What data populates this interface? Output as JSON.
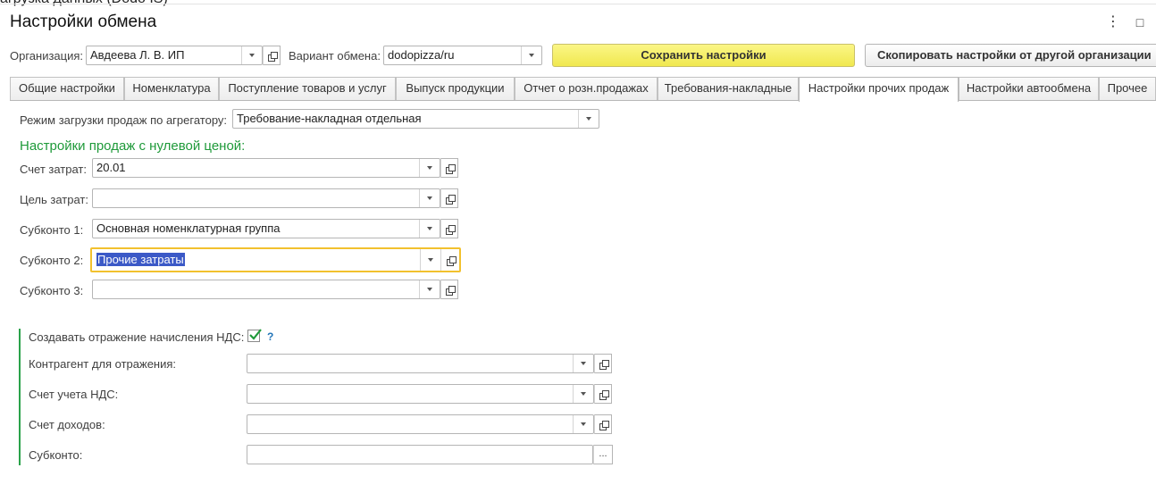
{
  "clipped_title": "агрузка данных (Dodo IS)",
  "window": {
    "title": "Настройки обмена",
    "more_icon": "⋮",
    "maximize_icon": "□"
  },
  "header": {
    "org_label": "Организация:",
    "org_value": "Авдеева Л. В. ИП",
    "variant_label": "Вариант обмена:",
    "variant_value": "dodopizza/ru",
    "save_button": "Сохранить настройки",
    "copy_button": "Скопировать настройки от другой организации"
  },
  "tabs": [
    {
      "label": "Общие настройки"
    },
    {
      "label": "Номенклатура"
    },
    {
      "label": "Поступление товаров и услуг"
    },
    {
      "label": "Выпуск продукции"
    },
    {
      "label": "Отчет о розн.продажах"
    },
    {
      "label": "Требования-накладные"
    },
    {
      "label": "Настройки прочих продаж"
    },
    {
      "label": "Настройки автообмена"
    },
    {
      "label": "Прочее"
    }
  ],
  "active_tab": "Настройки прочих продаж",
  "aggregator": {
    "label": "Режим загрузки продаж по агрегатору:",
    "value": "Требование-накладная отдельная"
  },
  "zero_price": {
    "title": "Настройки продаж с нулевой ценой:",
    "fields": [
      {
        "label": "Счет затрат:",
        "value": "20.01"
      },
      {
        "label": "Цель затрат:",
        "value": ""
      },
      {
        "label": "Субконто 1:",
        "value": "Основная номенклатурная группа"
      },
      {
        "label": "Субконто 2:",
        "value": "Прочие затраты"
      },
      {
        "label": "Субконто 3:",
        "value": ""
      }
    ]
  },
  "vat": {
    "create_label": "Создавать отражение начисления НДС:",
    "create_checked": true,
    "help": "?",
    "fields": [
      {
        "label": "Контрагент для отражения:",
        "value": ""
      },
      {
        "label": "Счет учета НДС:",
        "value": ""
      },
      {
        "label": "Счет доходов:",
        "value": ""
      },
      {
        "label": "Субконто:",
        "value": ""
      }
    ],
    "choose_button": "..."
  }
}
